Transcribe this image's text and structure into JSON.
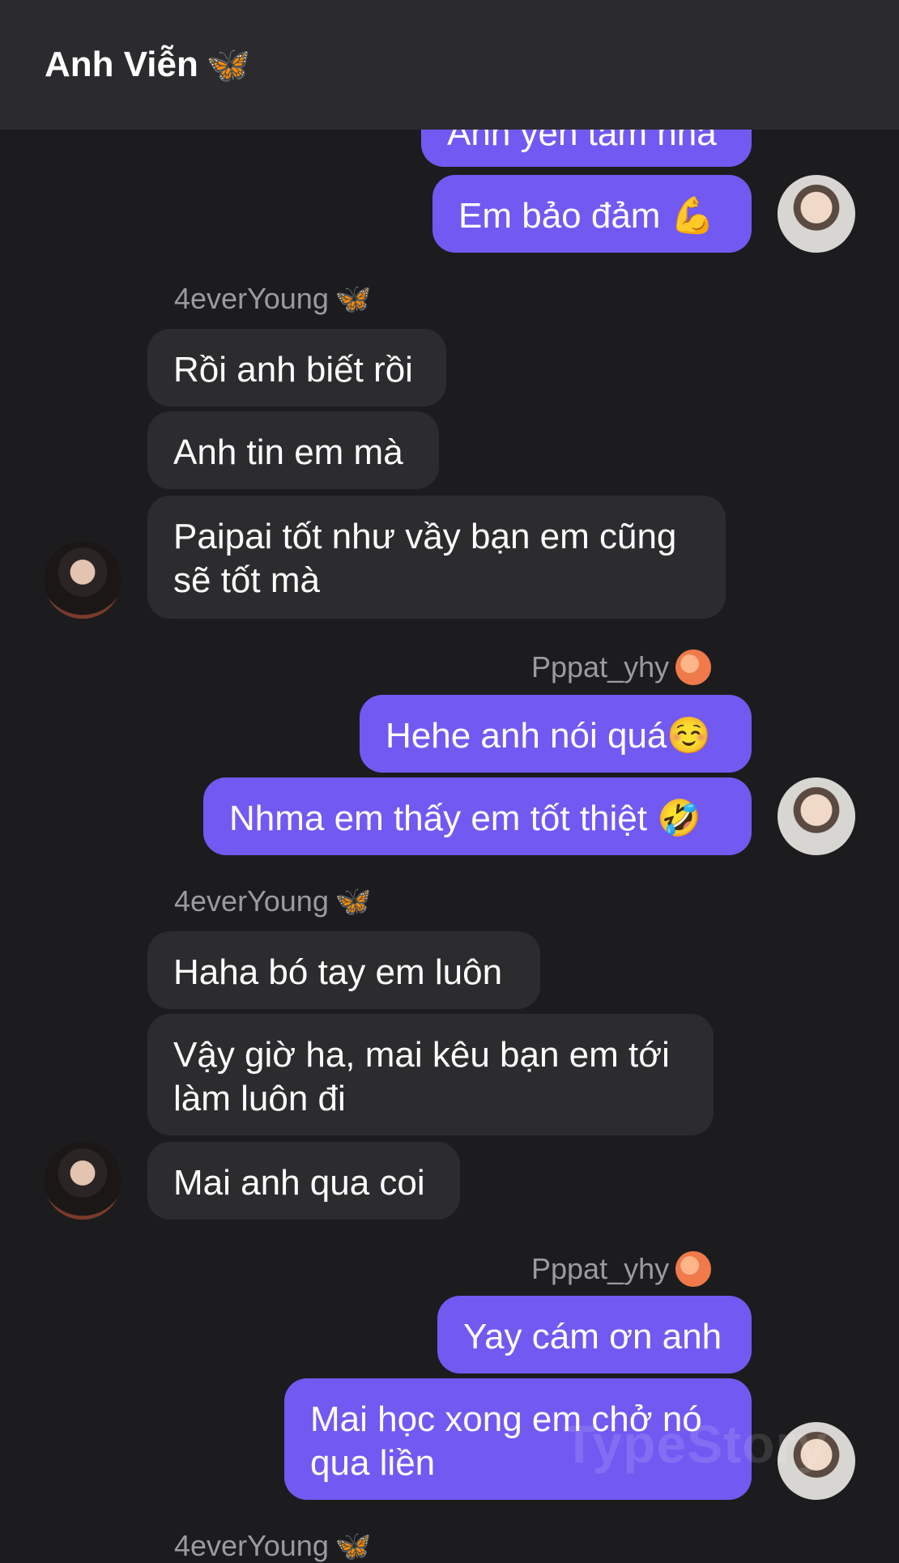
{
  "header": {
    "title": "Anh Viễn",
    "title_emoji": "🦋"
  },
  "messages": {
    "m0": "Anh yên tâm nha",
    "m1": "Em bảo đảm 💪",
    "s1": "4everYoung",
    "m2": "Rồi anh biết rồi",
    "m3": "Anh tin em mà",
    "m4": "Paipai tốt như vầy bạn em cũng sẽ tốt mà",
    "s2": "Pppat_yhy",
    "m5": "Hehe anh nói quá☺️",
    "m6": "Nhma em thấy em tốt thiệt 🤣",
    "s3": "4everYoung",
    "m7": "Haha bó tay em luôn",
    "m8": "Vậy giờ ha, mai kêu bạn em tới làm luôn đi",
    "m9": "Mai anh qua coi",
    "s4": "Pppat_yhy",
    "m10": "Yay cám ơn anh",
    "m11": "Mai học xong em chở nó qua liền",
    "s5": "4everYoung"
  },
  "emoji": {
    "butterfly": "🦋",
    "peach": "🍑"
  },
  "watermark": "TypeStory",
  "colors": {
    "outgoing": "#7259f2",
    "incoming": "#2c2c2e",
    "background": "#1c1c1e",
    "header": "#2b2b2e"
  }
}
